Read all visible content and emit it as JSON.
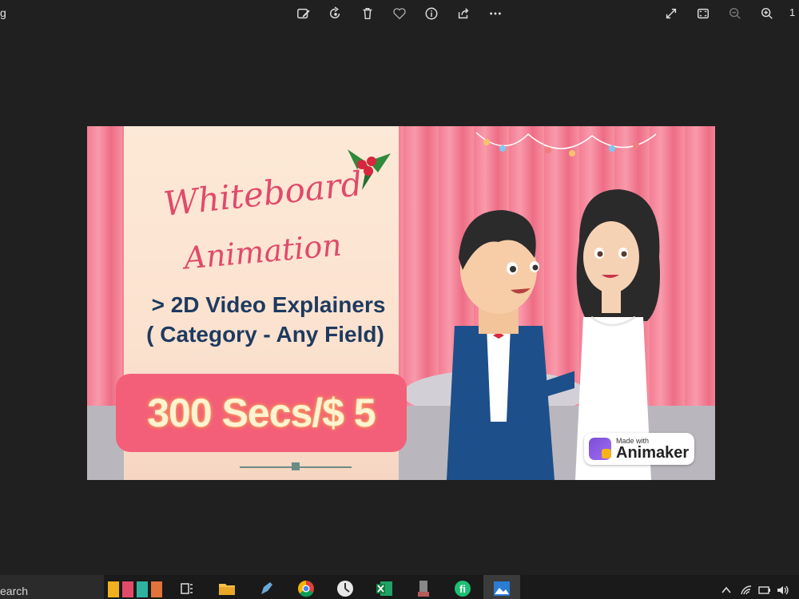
{
  "window": {
    "title_fragment": "g",
    "zoom_fragment": "1",
    "toolbar": {
      "edit_icon": "edit-image-icon",
      "rotate_icon": "rotate-icon",
      "delete_icon": "delete-icon",
      "favorite_icon": "heart-icon",
      "info_icon": "info-icon",
      "share_icon": "share-icon",
      "more_icon": "more-icon",
      "fullscreen_icon": "expand-icon",
      "fit_icon": "fit-window-icon",
      "zoom_out_icon": "zoom-out-icon",
      "zoom_in_icon": "zoom-in-icon"
    }
  },
  "image": {
    "headline_script_1": "Whiteboard",
    "headline_script_2": "Animation",
    "line1": "> 2D Video Explainers",
    "line2": "( Category - Any Field)",
    "price": "300 Secs/$ 5",
    "badge_small": "Made with",
    "badge_big": "Animaker"
  },
  "taskbar": {
    "search_fragment": "earch",
    "apps": [
      "task-view-icon",
      "file-explorer-icon",
      "pen-app-icon",
      "chrome-icon",
      "clock-app-icon",
      "excel-icon",
      "device-app-icon",
      "fiverr-icon",
      "photos-icon"
    ],
    "tray": [
      "chevron-up-icon",
      "wifi-icon",
      "network-icon",
      "volume-icon"
    ]
  },
  "colors": {
    "background": "#202020",
    "curtain": "#f47d94",
    "panel": "#fde9d7",
    "price_box": "#f35f78",
    "navy_text": "#1e3a5f",
    "script_text": "#e04a6a"
  }
}
